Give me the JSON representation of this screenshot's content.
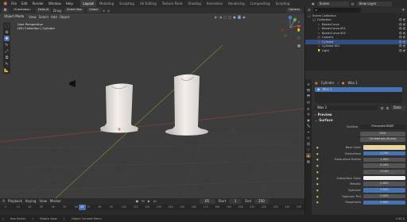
{
  "menubar": {
    "items": [
      "File",
      "Edit",
      "Render",
      "Window",
      "Help"
    ],
    "tabs": [
      "Layout",
      "Modeling",
      "Sculpting",
      "UV Editing",
      "Texture Paint",
      "Shading",
      "Animation",
      "Rendering",
      "Compositing",
      "Scripting"
    ],
    "active_tab": "Layout",
    "scene_label": "Scene",
    "view_layer_label": "View Layer"
  },
  "header": {
    "orientation_label": "Orientation:",
    "orientation_value": "Default",
    "drag_label": "Drag:",
    "drag_value": "Select Box",
    "transform_value": "Global",
    "options_label": "Options",
    "mode": "Object Mode",
    "view_menu": [
      "View",
      "Select",
      "Add",
      "Object"
    ]
  },
  "viewport": {
    "title": "User Perspective",
    "subtitle": "(65) Collection | Cylinder",
    "background": "#3d3d3d"
  },
  "outliner": {
    "root": "Scene Collection",
    "items": [
      {
        "name": "Collection",
        "icon": "collection-icon",
        "depth": 1
      },
      {
        "name": "BezierCurve",
        "icon": "curve-icon",
        "depth": 2
      },
      {
        "name": "BezierCurve.001",
        "icon": "curve-icon",
        "depth": 2
      },
      {
        "name": "BezierCurve.002",
        "icon": "curve-icon",
        "depth": 2
      },
      {
        "name": "Camera",
        "icon": "camera-icon",
        "depth": 2
      },
      {
        "name": "Cylinder",
        "icon": "mesh-icon",
        "depth": 2
      },
      {
        "name": "Cylinder.001",
        "icon": "mesh-icon",
        "depth": 2
      },
      {
        "name": "Light",
        "icon": "light-icon",
        "depth": 2
      }
    ]
  },
  "properties": {
    "object_name": "Cylinder",
    "material_name": "Wax 1",
    "slot_name": "Wax 1",
    "data_label": "Data",
    "preview_label": "Preview",
    "surface_section": "Surface",
    "surface_label": "Surface",
    "surface_value": "Principled BSDF",
    "distribution": "GGX",
    "subsurface_method": "Christensen-Burley",
    "rows": [
      {
        "label": "Base Color",
        "value": "",
        "kind": "color",
        "color": "#e8d5a0"
      },
      {
        "label": "Subsurface",
        "value": "0.700",
        "kind": "blue"
      },
      {
        "label": "Subsurface Radius",
        "value": "1.000",
        "kind": "plain"
      },
      {
        "label": "",
        "value": "0.200",
        "kind": "plain"
      },
      {
        "label": "",
        "value": "0.100",
        "kind": "plain"
      },
      {
        "label": "Subsurface Color",
        "value": "",
        "kind": "color",
        "color": "#f2f2f2"
      },
      {
        "label": "Metallic",
        "value": "0.000",
        "kind": "plain"
      },
      {
        "label": "Specular",
        "value": "0.500",
        "kind": "blue"
      },
      {
        "label": "Specular Tint",
        "value": "0.000",
        "kind": "plain"
      },
      {
        "label": "Roughness",
        "value": "0.500",
        "kind": "blue"
      }
    ]
  },
  "timeline": {
    "menus": [
      "Playback",
      "Keying",
      "View",
      "Marker"
    ],
    "current_frame": "65",
    "start_frame": "1",
    "end_frame": "250",
    "ticks": [
      "0",
      "10",
      "20",
      "30",
      "40",
      "50",
      "60",
      "70",
      "80",
      "90",
      "100",
      "110",
      "120",
      "130",
      "140",
      "150",
      "160",
      "170",
      "180",
      "190",
      "200",
      "210",
      "220",
      "230",
      "240",
      "250"
    ]
  },
  "statusbar": {
    "select": "Box Select",
    "rotate": "Rotate View",
    "context": "Object Context Menu",
    "version": "2.90.0"
  }
}
